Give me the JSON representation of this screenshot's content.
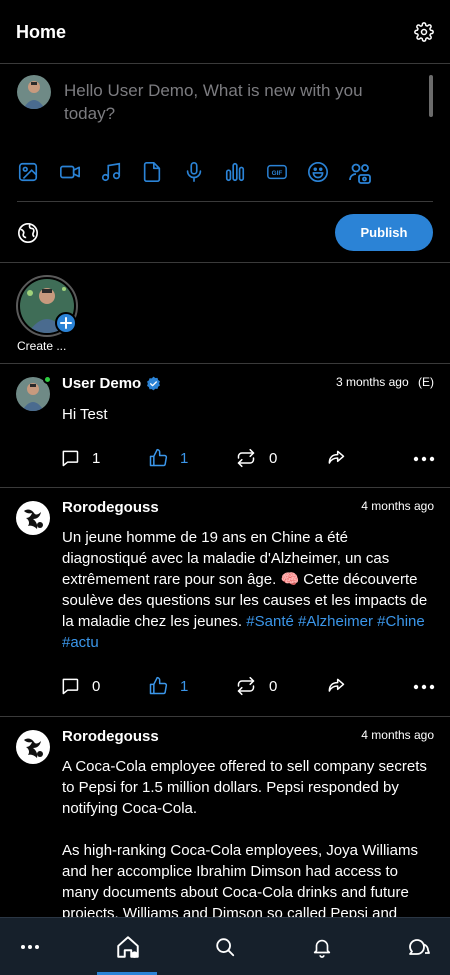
{
  "header": {
    "title": "Home",
    "settings_icon": "gear-icon"
  },
  "composer": {
    "placeholder": "Hello User Demo, What is new with you today?",
    "tools": [
      "image-icon",
      "video-icon",
      "music-icon",
      "file-icon",
      "mic-icon",
      "poll-icon",
      "gif-icon",
      "emoji-icon",
      "users-icon"
    ],
    "gif_label": "GIF",
    "publish_label": "Publish",
    "audience_icon": "globe-icon"
  },
  "stories": {
    "create_label": "Create ..."
  },
  "posts": [
    {
      "author": "User Demo",
      "verified": true,
      "time": "3 months ago",
      "edited": "(E)",
      "text": "Hi Test",
      "comments": "1",
      "likes": "1",
      "reposts": "0"
    },
    {
      "author": "Rorodegouss",
      "time": "4 months ago",
      "text": "Un jeune homme de 19 ans en Chine a été diagnostiqué avec la maladie d'Alzheimer, un cas extrêmement rare pour son âge. 🧠 Cette découverte soulève des questions sur les causes et les impacts de la maladie chez les jeunes.",
      "hashtags": "#Santé #Alzheimer #Chine #actu",
      "comments": "0",
      "likes": "1",
      "reposts": "0"
    },
    {
      "author": "Rorodegouss",
      "time": "4 months ago",
      "paragraph1": "A Coca-Cola employee offered to sell company secrets to Pepsi for 1.5 million dollars. Pepsi responded by notifying Coca-Cola.",
      "paragraph2": "As high-ranking Coca-Cola employees, Joya Williams and her accomplice Ibrahim Dimson had access to many documents about Coca-Cola drinks and future projects. Williams and Dimson so called Pepsi and"
    }
  ],
  "colors": {
    "accent": "#2b83d6",
    "link": "#3b96e9",
    "online": "#2ecc40",
    "nav_bg": "#16202b"
  },
  "nav": [
    "more-icon",
    "home-icon",
    "search-icon",
    "bell-icon",
    "chat-icon"
  ]
}
